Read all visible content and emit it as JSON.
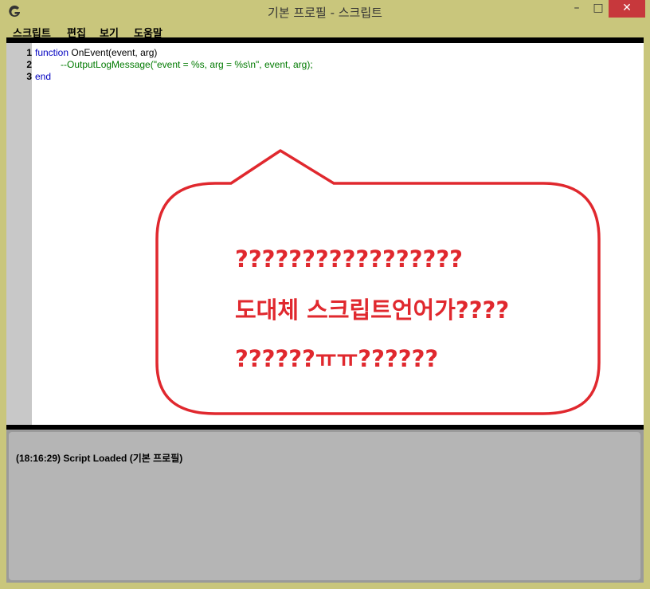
{
  "window": {
    "title": "기본 프로필 - 스크립트",
    "minimize": "–",
    "maximize": "□",
    "close": "✕"
  },
  "menu": [
    "스크립트",
    "편집",
    "보기",
    "도움말"
  ],
  "editor": {
    "line_numbers": [
      "1",
      "2",
      "3"
    ],
    "code": {
      "line1_keyword": "function",
      "line1_rest": " OnEvent(event, arg)",
      "line2_comment": "--OutputLogMessage(\"event = %s, arg = %s\\n\", event, arg);",
      "line3_keyword": "end"
    }
  },
  "annotation": {
    "line1": "?????????????????",
    "line2": "도대체 스크립트언어가????",
    "line3": "??????ㅠㅠ??????",
    "color": "#e0282e"
  },
  "log": {
    "message": "(18:16:29) Script Loaded (기본 프로필)"
  }
}
